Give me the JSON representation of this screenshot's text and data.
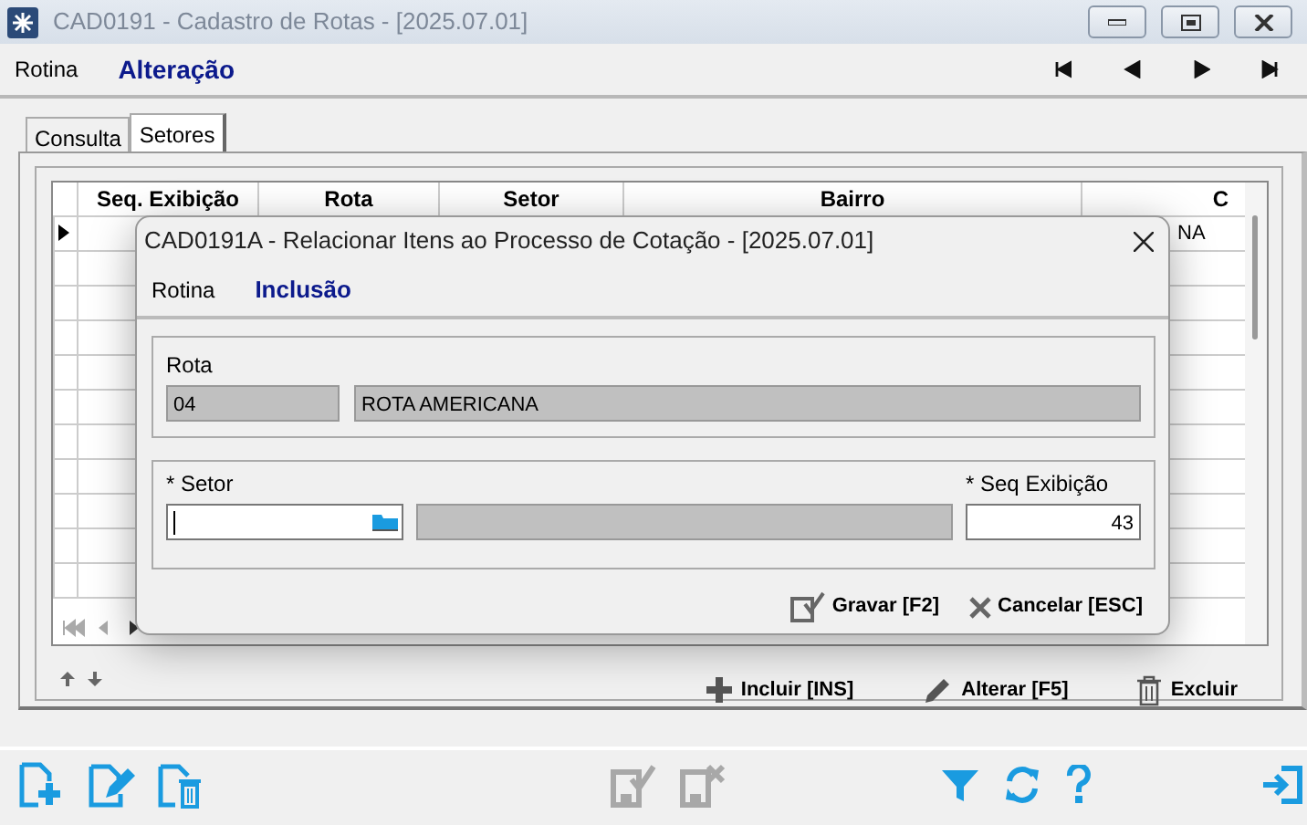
{
  "window": {
    "title": "CAD0191 - Cadastro de Rotas - [2025.07.01]"
  },
  "header": {
    "label": "Rotina",
    "mode": "Alteração"
  },
  "tabs": [
    {
      "label": "Consulta",
      "selected": false
    },
    {
      "label": "Setores",
      "selected": true
    }
  ],
  "grid": {
    "columns": [
      "Seq. Exibição",
      "Rota",
      "Setor",
      "Bairro",
      "C"
    ],
    "rows": [
      {
        "current": true,
        "column_5": "NA"
      }
    ]
  },
  "actions": [
    {
      "kind": "add",
      "label": "Incluir [INS]"
    },
    {
      "kind": "edit",
      "label": "Alterar [F5]"
    },
    {
      "kind": "delete",
      "label": "Excluir"
    }
  ],
  "toolbar": [
    {
      "kind": "new",
      "disabled": false
    },
    {
      "kind": "edit",
      "disabled": false
    },
    {
      "kind": "delete",
      "disabled": false
    },
    {
      "kind": "save",
      "disabled": true
    },
    {
      "kind": "cancel",
      "disabled": true
    },
    {
      "kind": "filter",
      "disabled": false
    },
    {
      "kind": "refresh",
      "disabled": false
    },
    {
      "kind": "help",
      "disabled": false
    },
    {
      "kind": "exit",
      "disabled": false
    }
  ],
  "dialog": {
    "title": "CAD0191A - Relacionar Itens ao Processo de Cotação - [2025.07.01]",
    "header": {
      "label": "Rotina",
      "mode": "Inclusão"
    },
    "rota": {
      "label": "Rota",
      "code": "04",
      "name": "ROTA AMERICANA"
    },
    "setor": {
      "label": "* Setor"
    },
    "seq": {
      "label": "* Seq Exibição",
      "value": "43"
    },
    "buttons": [
      {
        "kind": "save",
        "label": "Gravar [F2]"
      },
      {
        "kind": "cancel",
        "label": "Cancelar [ESC]"
      }
    ]
  }
}
